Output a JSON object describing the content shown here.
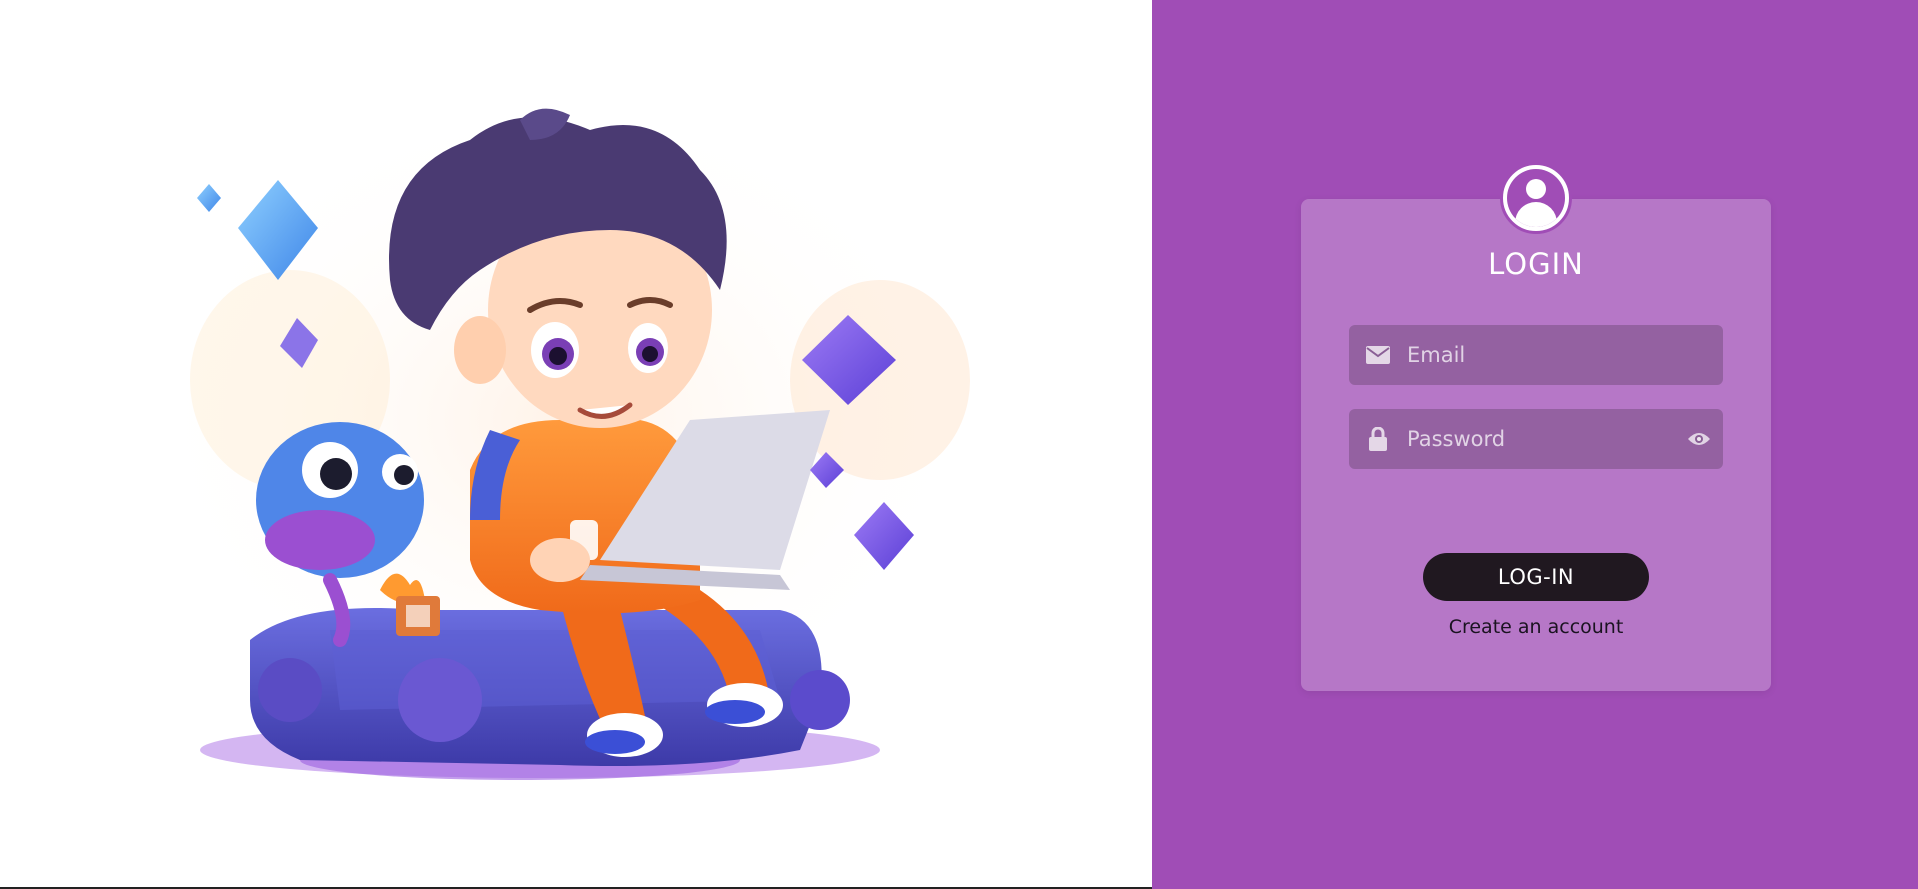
{
  "login": {
    "title": "LOGIN",
    "email_placeholder": "Email",
    "password_placeholder": "Password",
    "login_button": "LOG-IN",
    "create_account": "Create an account"
  },
  "icons": {
    "avatar": "user-avatar-icon",
    "email": "envelope-icon",
    "password": "lock-icon",
    "toggle": "eye-icon"
  },
  "colors": {
    "panel_bg": "#a04db6",
    "card_bg": "rgba(255,255,255,0.24)",
    "field_bg": "rgba(120,80,130,0.55)",
    "button_bg": "#201820",
    "button_text": "#ffffff"
  }
}
